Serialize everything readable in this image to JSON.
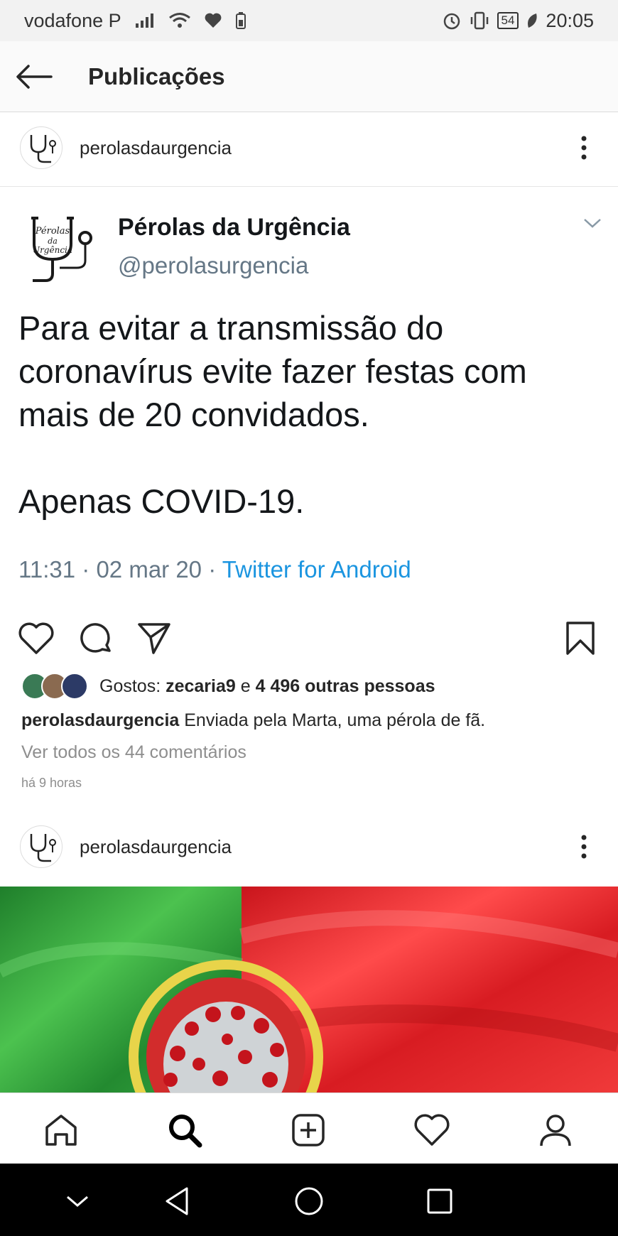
{
  "status_bar": {
    "carrier": "vodafone P",
    "battery": "54",
    "time": "20:05"
  },
  "header": {
    "title": "Publicações"
  },
  "post1": {
    "username": "perolasdaurgencia",
    "tweet": {
      "name": "Pérolas da Urgência",
      "handle": "@perolasurgencia",
      "line1": "Para evitar a transmissão do",
      "line2": "coronavírus evite fazer festas com",
      "line3": "mais de 20 convidados.",
      "line4": "Apenas COVID-19.",
      "time": "11:31 · 02 mar 20 · ",
      "source": "Twitter for Android"
    },
    "likes_prefix": "Gostos: ",
    "likes_user": "zecaria9",
    "likes_mid": " e ",
    "likes_others": "4 496 outras pessoas",
    "caption_user": "perolasdaurgencia",
    "caption_text": " Enviada pela Marta, uma pérola de fã.",
    "comments_link": "Ver todos os 44 comentários",
    "posted": "há 9 horas"
  },
  "post2": {
    "username": "perolasdaurgencia"
  },
  "colors": {
    "flag_green": "#2f9e3a",
    "flag_red": "#e0262b",
    "twitter_blue": "#1b95e0"
  }
}
